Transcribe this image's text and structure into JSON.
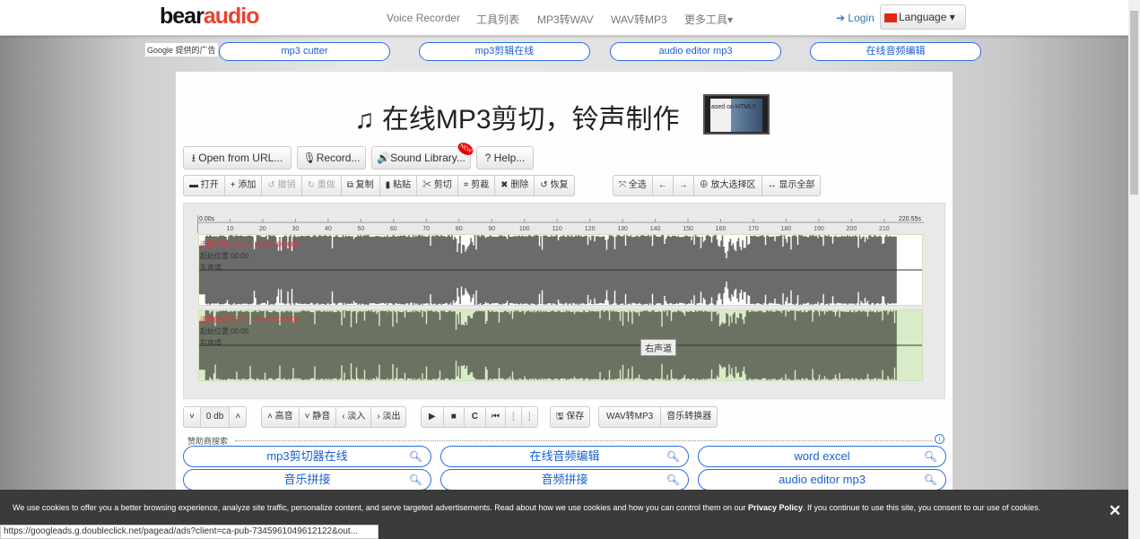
{
  "nav": {
    "logo_a": "bear",
    "logo_b": "audio",
    "links": [
      "Voice Recorder",
      "工具列表",
      "MP3转WAV",
      "WAV转MP3",
      "更多工具▾"
    ],
    "login": "Login",
    "language": "Language ▾"
  },
  "ads": {
    "label": "Google 提供的广告",
    "items": [
      "mp3 cutter",
      "mp3剪辑在线",
      "audio editor mp3",
      "在线音频编辑"
    ]
  },
  "title": "♫ 在线MP3剪切，铃声制作",
  "thumb_text": "ased on HTML5",
  "top_buttons": [
    "Open from URL...",
    "Record...",
    "Sound Library...",
    "? Help..."
  ],
  "new_badge": "NEW",
  "edit_group": [
    {
      "icon": "folder-open-icon",
      "label": "▬ 打开"
    },
    {
      "icon": "plus-icon",
      "label": "+ 添加"
    },
    {
      "icon": "undo-icon",
      "label": "↺ 撤销",
      "disabled": true
    },
    {
      "icon": "redo-icon",
      "label": "↻ 重做",
      "disabled": true
    },
    {
      "icon": "copy-icon",
      "label": "⧉ 复制"
    },
    {
      "icon": "paste-icon",
      "label": "▮ 粘贴"
    },
    {
      "icon": "scissors-icon",
      "label": "✂ 剪切"
    },
    {
      "icon": "crop-icon",
      "label": "⌗ 剪裁"
    },
    {
      "icon": "delete-icon",
      "label": "✖ 删除"
    },
    {
      "icon": "restore-icon",
      "label": "↺ 恢复"
    }
  ],
  "view_group": [
    {
      "icon": "select-all-icon",
      "label": "⤧ 全选"
    },
    {
      "icon": "arrow-left-icon",
      "label": "←"
    },
    {
      "icon": "arrow-right-icon",
      "label": "→"
    },
    {
      "icon": "zoom-icon",
      "label": "⊕ 放大选择区"
    },
    {
      "icon": "expand-icon",
      "label": "↔ 显示全部"
    }
  ],
  "ruler": {
    "start": "0.00s",
    "end": "220.55s",
    "ticks": [
      10,
      20,
      30,
      40,
      50,
      60,
      70,
      80,
      90,
      100,
      110,
      120,
      130,
      140,
      150,
      160,
      170,
      180,
      190,
      200,
      210
    ],
    "duration": 220.55
  },
  "channels": [
    {
      "selection": "选择区域:00:00 - 00:00 (00:00)",
      "position": "起始位置:00:00",
      "name": "左声道",
      "color": "#6b6b6b",
      "peak": "#ffffff"
    },
    {
      "selection": "选择区域:00:00 - 00:00 (00:00)",
      "position": "起始位置:00:00",
      "name": "右声道",
      "color": "#6c7262",
      "peak": "#d9ecc8"
    }
  ],
  "tooltip": "右声道",
  "volume": {
    "down": "˅",
    "value": "0 db",
    "up": "˄"
  },
  "effects": [
    "˄ 高音",
    "˅ 静音",
    "‹ 淡入",
    "› 淡出"
  ],
  "playback": [
    "▶",
    "■",
    "C",
    "⏮",
    "[",
    "]"
  ],
  "save": "🖫 保存",
  "convert": [
    "WAV转MP3",
    "音乐转换器"
  ],
  "sponsor_label": "赞助商搜索",
  "searches": [
    "mp3剪切器在线",
    "在线音频编辑",
    "word excel",
    "音乐拼接",
    "音频拼接",
    "audio editor mp3"
  ],
  "cookie": {
    "text1": "We use cookies to offer you a better browsing experience, analyze site traffic, personalize content, and serve targeted advertisements. Read about how we use cookies and how you can control them on our ",
    "link": "Privacy Policy",
    "text2": ". If you continue to use this site, you consent to our use of cookies.",
    "close": "✕"
  },
  "status_url": "https://googleads.g.doubleclick.net/pagead/ads?client=ca-pub-7345961049612122&out..."
}
